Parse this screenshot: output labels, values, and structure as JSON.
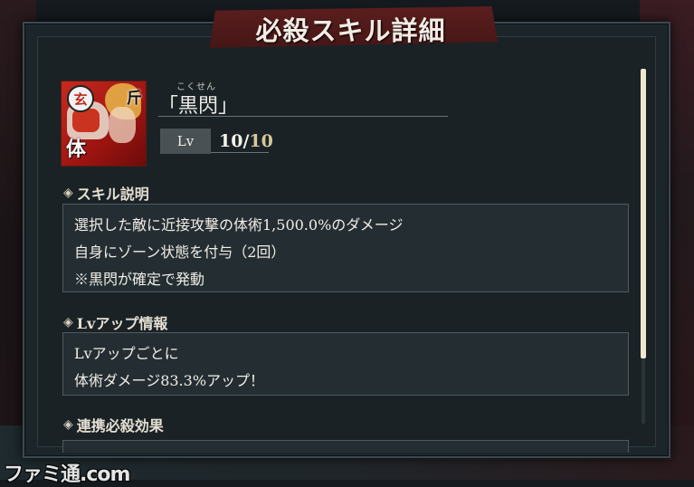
{
  "dialog": {
    "title": "必殺スキル詳細"
  },
  "skill": {
    "icon_badge": "玄",
    "icon_top_glyph": "斤",
    "icon_bottom_glyph": "体",
    "ruby": "こくせん",
    "name": "「黒閃」",
    "level_label": "Lv",
    "level_current": "10",
    "level_separator": "/",
    "level_max": "10"
  },
  "sections": {
    "description": {
      "header": "スキル説明",
      "lines": [
        "選択した敵に近接攻撃の体術1,500.0%のダメージ",
        "自身にゾーン状態を付与（2回）",
        "※黒閃が確定で発動"
      ]
    },
    "levelup": {
      "header": "Lvアップ情報",
      "lines": [
        "Lvアップごとに",
        "体術ダメージ83.3%アップ！"
      ]
    },
    "combo": {
      "header": "連携必殺効果"
    }
  },
  "icons": {
    "section_marker": "diamond-icon"
  },
  "scroll": {
    "position_fraction": 0.0
  },
  "watermark": "ファミ通.com"
}
